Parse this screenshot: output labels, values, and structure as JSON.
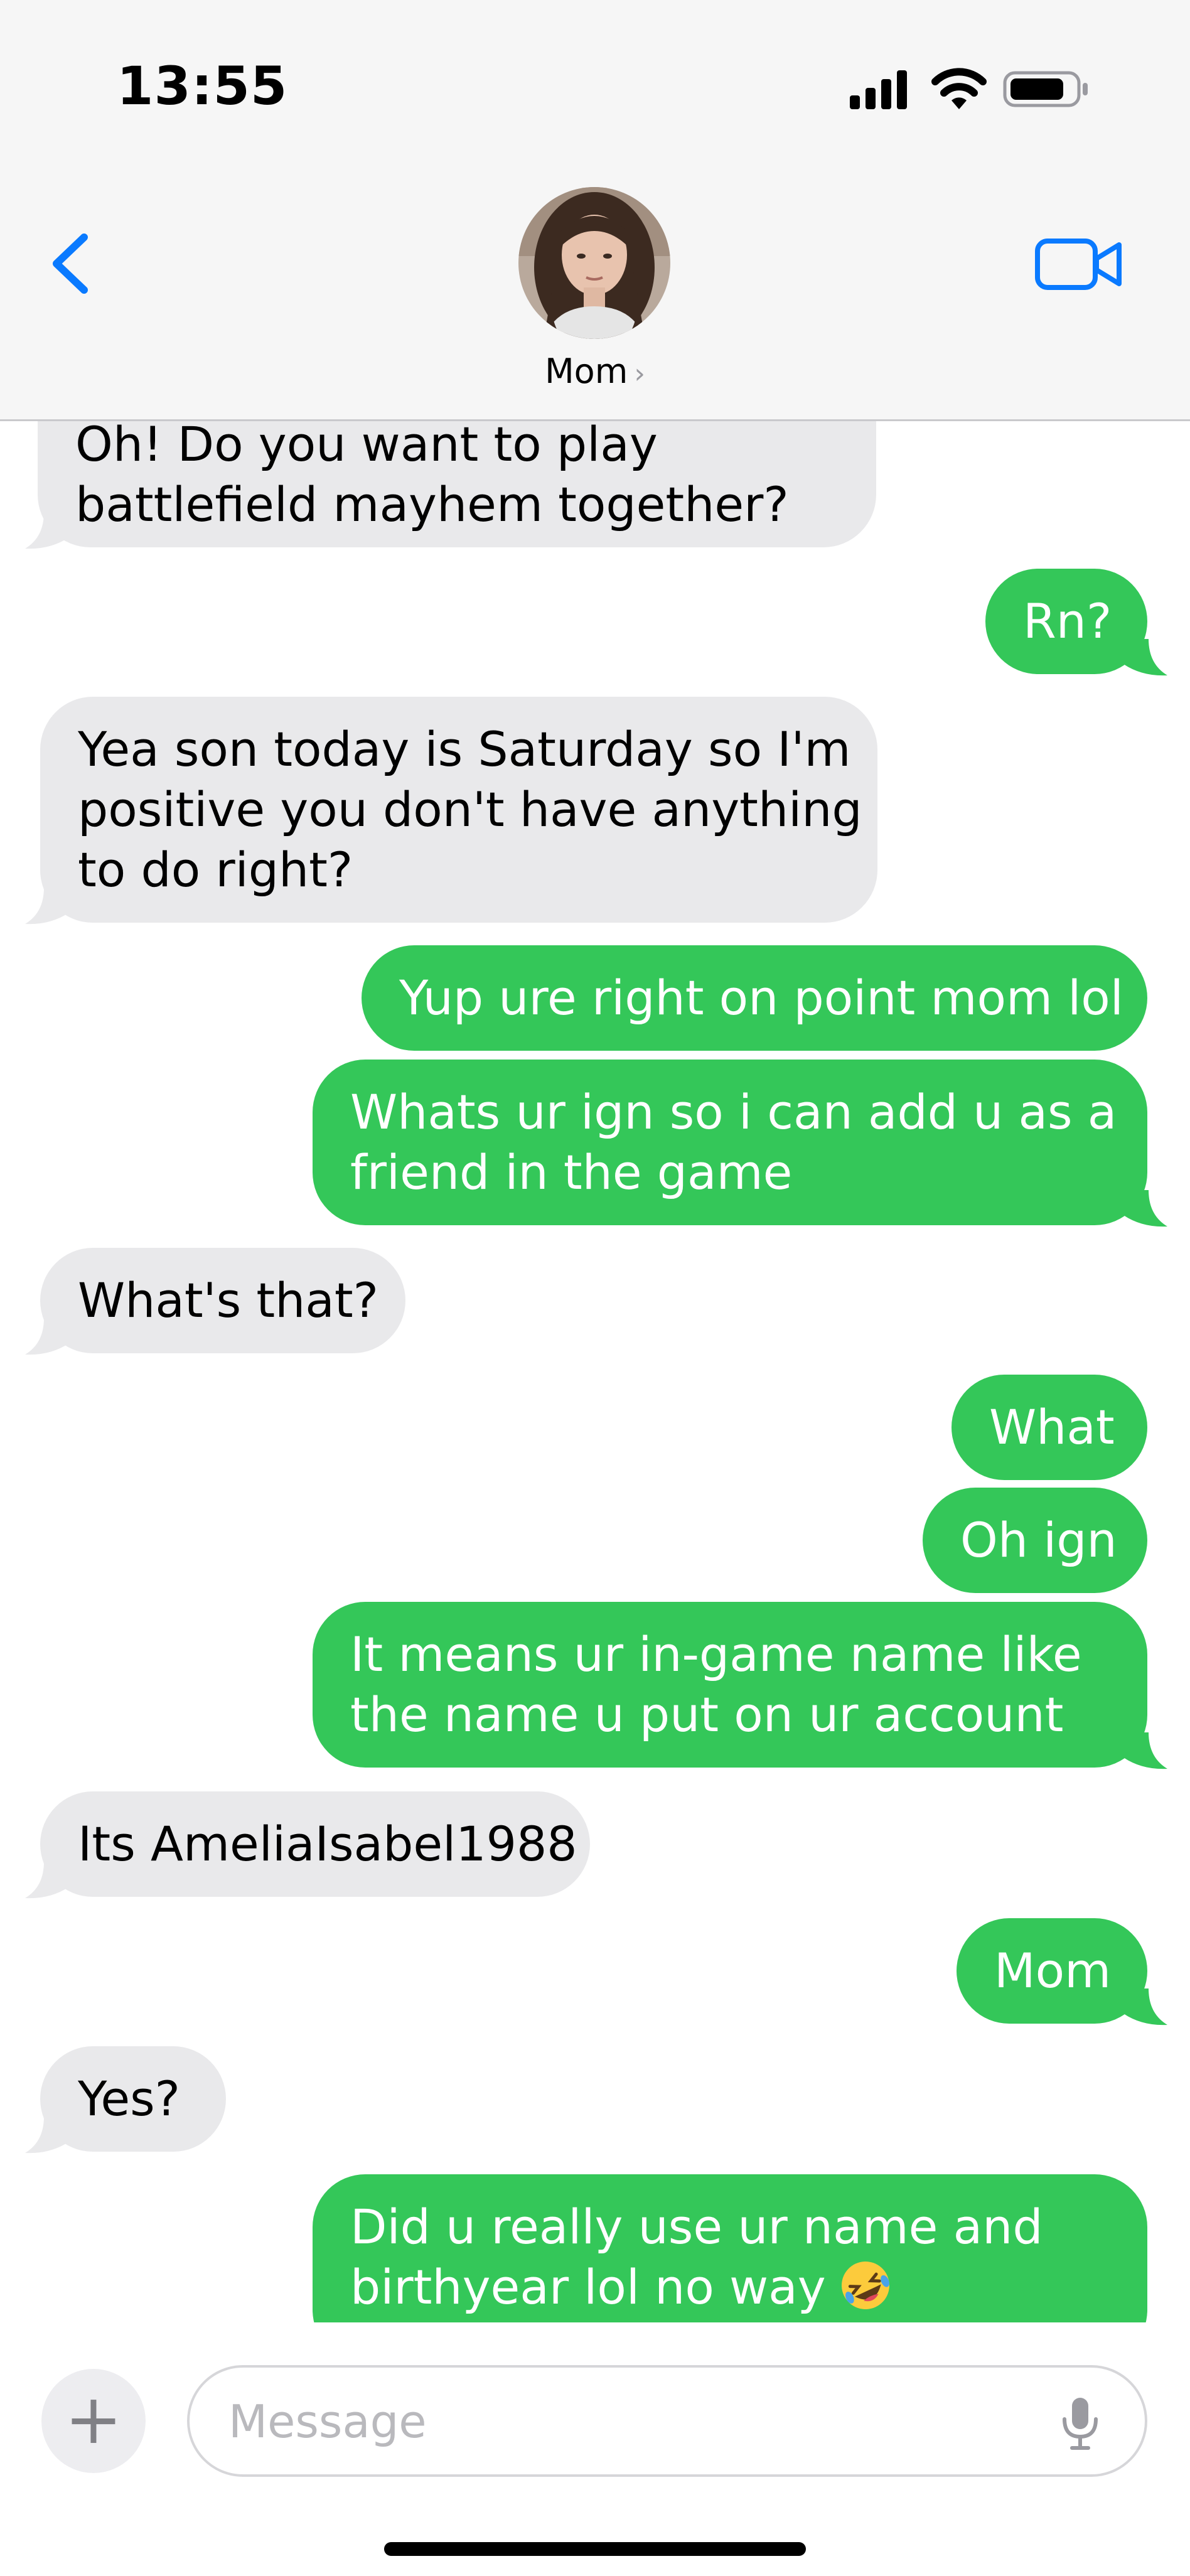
{
  "status_bar": {
    "time": "13:55"
  },
  "header": {
    "contact_name": "Mom",
    "name_chevron": "›",
    "back_icon": "chevron-left-icon",
    "video_icon": "video-camera-icon",
    "accent_color": "#0a7aff"
  },
  "messages": [
    {
      "side": "received",
      "lines": [
        "Oh! Do you want to play",
        "battlefield mayhem together?"
      ]
    },
    {
      "side": "sent",
      "lines": [
        "Rn?"
      ]
    },
    {
      "side": "received",
      "lines": [
        "Yea son today is Saturday so I'm",
        "positive you don't have anything",
        "to do right?"
      ]
    },
    {
      "side": "sent",
      "lines": [
        "Yup ure right on point mom lol"
      ]
    },
    {
      "side": "sent",
      "lines": [
        "Whats ur ign so i can add u as a",
        "friend in the game"
      ]
    },
    {
      "side": "received",
      "lines": [
        "What's that?"
      ]
    },
    {
      "side": "sent",
      "lines": [
        "What"
      ]
    },
    {
      "side": "sent",
      "lines": [
        "Oh ign"
      ]
    },
    {
      "side": "sent",
      "lines": [
        "It means ur in-game name like",
        "the name u put on ur account"
      ]
    },
    {
      "side": "received",
      "lines": [
        "Its AmeliaIsabel1988"
      ]
    },
    {
      "side": "sent",
      "lines": [
        "Mom"
      ]
    },
    {
      "side": "received",
      "lines": [
        "Yes?"
      ]
    },
    {
      "side": "sent",
      "lines": [
        "Did u really use ur name and",
        "birthyear lol no way"
      ],
      "emoji": "rolling-on-floor-laughing-emoji"
    }
  ],
  "composer": {
    "plus_label": "+",
    "placeholder": "Message",
    "mic_icon": "microphone-icon"
  },
  "colors": {
    "sent_bubble": "#34c759",
    "received_bubble": "#e9e9eb",
    "header_bg": "#f6f6f6"
  }
}
